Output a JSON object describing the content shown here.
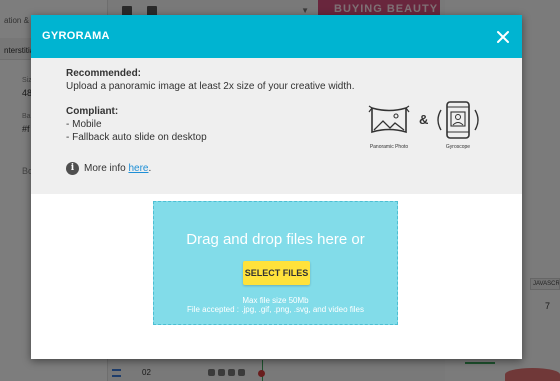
{
  "background": {
    "tab_label": "ation & D",
    "section_label": "nterstitial",
    "small_label_1": "Siz",
    "value_1": "48",
    "small_label_2": "Ba",
    "value_2": "#f",
    "small_label_3": "Bo",
    "banner_text": "BUYING BEAUTY",
    "column_header": "JAVASCRI",
    "column_value": "7",
    "row_number": "02"
  },
  "modal": {
    "title": "GYRORAMA",
    "recommended_title": "Recommended:",
    "recommended_text": "Upload a panoramic image at least 2x size of your creative width.",
    "compliant_title": "Compliant:",
    "compliant_items": [
      "- Mobile",
      "- Fallback auto slide on desktop"
    ],
    "more_info_prefix": "More info ",
    "more_info_link": "here",
    "more_info_suffix": ".",
    "icon_1_caption": "Panoramic Photo",
    "ampersand": "&",
    "icon_2_caption": "Gyroscope"
  },
  "dropzone": {
    "title": "Drag and drop files here or",
    "button_label": "SELECT FILES",
    "max_size": "Max file size 50Mb",
    "accepted": "File accepted : .jpg, .gif, .png, .svg, and video files"
  },
  "colors": {
    "header": "#00b4d1",
    "dropzone": "#82dce9",
    "button": "#ffe23b",
    "link": "#1e8fd6"
  },
  "icons": [
    "close-icon",
    "info-icon",
    "panoramic-photo-icon",
    "gyroscope-icon"
  ]
}
